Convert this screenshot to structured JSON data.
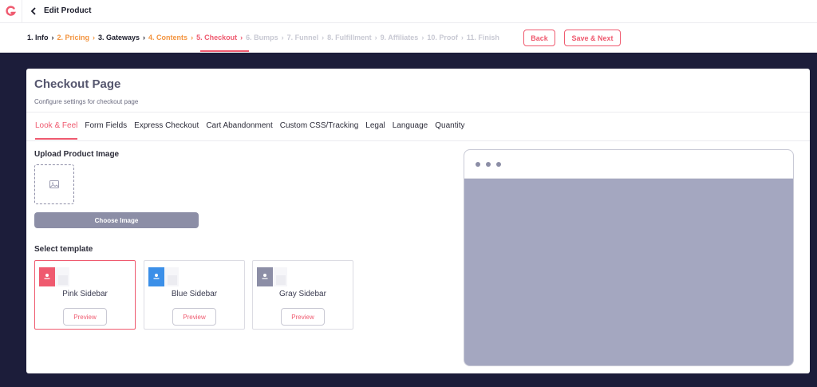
{
  "header": {
    "title": "Edit Product",
    "steps": [
      {
        "label": "1. Info",
        "state": "done"
      },
      {
        "label": "2. Pricing",
        "state": "partial"
      },
      {
        "label": "3. Gateways",
        "state": "done"
      },
      {
        "label": "4. Contents",
        "state": "partial"
      },
      {
        "label": "5. Checkout",
        "state": "active"
      },
      {
        "label": "6. Bumps",
        "state": "todo"
      },
      {
        "label": "7. Funnel",
        "state": "todo"
      },
      {
        "label": "8. Fulfillment",
        "state": "todo"
      },
      {
        "label": "9. Affiliates",
        "state": "todo"
      },
      {
        "label": "10. Proof",
        "state": "todo"
      },
      {
        "label": "11. Finish",
        "state": "todo"
      }
    ],
    "back_label": "Back",
    "save_next_label": "Save & Next"
  },
  "card": {
    "title": "Checkout Page",
    "subtitle": "Configure settings for checkout page",
    "tabs": [
      "Look & Feel",
      "Form Fields",
      "Express Checkout",
      "Cart Abandonment",
      "Custom CSS/Tracking",
      "Legal",
      "Language",
      "Quantity"
    ],
    "active_tab": "Look & Feel"
  },
  "upload": {
    "label": "Upload Product Image",
    "button_label": "Choose Image"
  },
  "templates": {
    "label": "Select template",
    "items": [
      {
        "name": "Pink Sidebar",
        "color": "#ef5a6f",
        "preview_label": "Preview",
        "selected": true
      },
      {
        "name": "Blue Sidebar",
        "color": "#3b8fe8",
        "preview_label": "Preview",
        "selected": false
      },
      {
        "name": "Gray Sidebar",
        "color": "#8c8ea6",
        "preview_label": "Preview",
        "selected": false
      }
    ]
  },
  "colors": {
    "accent": "#ef5a6f",
    "orange": "#f3943f",
    "page_background": "#1c1d3a",
    "preview_fill": "#a4a7c0"
  }
}
